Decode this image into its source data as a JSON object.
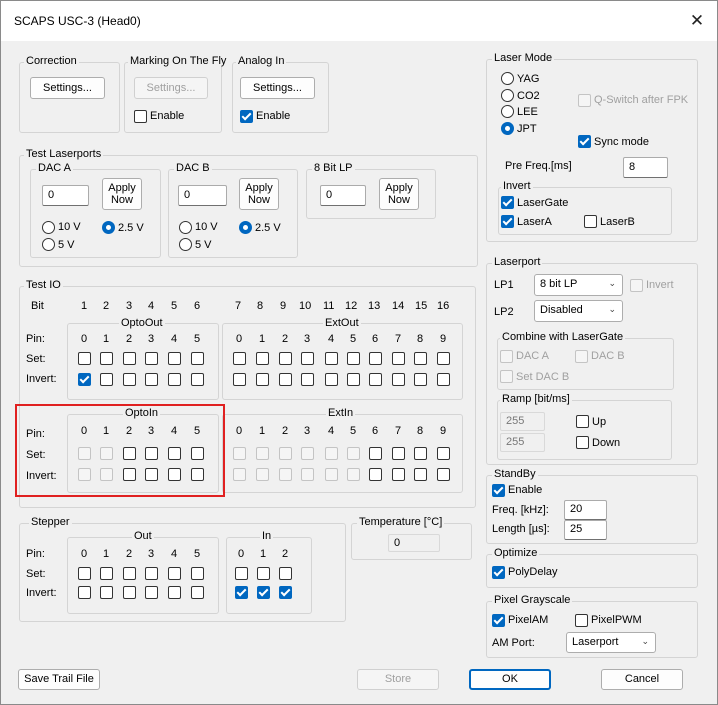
{
  "window": {
    "title": "SCAPS USC-3 (Head0)",
    "close_glyph": "✕"
  },
  "correction": {
    "title": "Correction",
    "settings": "Settings..."
  },
  "marking": {
    "title": "Marking On The Fly",
    "settings": "Settings...",
    "enable": "Enable",
    "enable_checked": false
  },
  "analog": {
    "title": "Analog In",
    "settings": "Settings...",
    "enable": "Enable",
    "enable_checked": true
  },
  "test_laserports": {
    "title": "Test Laserports",
    "dac_a": {
      "title": "DAC A",
      "value": "0",
      "apply": [
        "Apply",
        "Now"
      ],
      "r10": "10 V",
      "r25": "2.5 V",
      "r5": "5 V",
      "selected": "2.5 V"
    },
    "dac_b": {
      "title": "DAC B",
      "value": "0",
      "apply": [
        "Apply",
        "Now"
      ],
      "r10": "10 V",
      "r25": "2.5 V",
      "r5": "5 V",
      "selected": "2.5 V"
    },
    "lp8": {
      "title": "8 Bit LP",
      "value": "0",
      "apply": [
        "Apply",
        "Now"
      ]
    }
  },
  "test_io": {
    "title": "Test IO",
    "bit_label": "Bit",
    "bits_a": [
      "1",
      "2",
      "3",
      "4",
      "5",
      "6"
    ],
    "bits_b": [
      "7",
      "8",
      "9",
      "10",
      "11",
      "12",
      "13",
      "14",
      "15",
      "16"
    ],
    "pin": "Pin:",
    "set": "Set:",
    "invert": "Invert:",
    "optoout": {
      "title": "OptoOut",
      "pins": [
        "0",
        "1",
        "2",
        "3",
        "4",
        "5"
      ],
      "invert_checked": [
        true,
        false,
        false,
        false,
        false,
        false
      ]
    },
    "extout": {
      "title": "ExtOut",
      "pins": [
        "0",
        "1",
        "2",
        "3",
        "4",
        "5",
        "6",
        "7",
        "8",
        "9"
      ]
    },
    "optoin": {
      "title": "OptoIn",
      "pins": [
        "0",
        "1",
        "2",
        "3",
        "4",
        "5"
      ]
    },
    "extin": {
      "title": "ExtIn",
      "pins": [
        "0",
        "1",
        "2",
        "3",
        "4",
        "5",
        "6",
        "7",
        "8",
        "9"
      ]
    }
  },
  "stepper": {
    "title": "Stepper",
    "out_title": "Out",
    "in_title": "In",
    "pin": "Pin:",
    "set": "Set:",
    "invert": "Invert:",
    "out_pins": [
      "0",
      "1",
      "2",
      "3",
      "4",
      "5"
    ],
    "in_pins": [
      "0",
      "1",
      "2"
    ],
    "in_invert_checked": [
      true,
      true,
      true
    ]
  },
  "temperature": {
    "title": "Temperature [°C]",
    "value": "0"
  },
  "laser_mode": {
    "title": "Laser Mode",
    "options": [
      "YAG",
      "CO2",
      "LEE",
      "JPT"
    ],
    "selected": "JPT",
    "qswitch": "Q-Switch after FPK",
    "sync": "Sync mode",
    "sync_checked": true,
    "prefreq_label": "Pre Freq.[ms]",
    "prefreq_value": "8",
    "invert_title": "Invert",
    "lasergate": "LaserGate",
    "lasergate_checked": true,
    "lasera": "LaserA",
    "lasera_checked": true,
    "laserb": "LaserB",
    "laserb_checked": false
  },
  "laserport": {
    "title": "Laserport",
    "lp1_label": "LP1",
    "lp1_value": "8 bit LP",
    "invert": "Invert",
    "lp2_label": "LP2",
    "lp2_value": "Disabled",
    "combine_title": "Combine with LaserGate",
    "daca": "DAC A",
    "dacb": "DAC B",
    "setdacb": "Set DAC B",
    "ramp_title": "Ramp [bit/ms]",
    "ramp_up_value": "255",
    "ramp_down_value": "255",
    "up": "Up",
    "down": "Down"
  },
  "standby": {
    "title": "StandBy",
    "enable": "Enable",
    "enable_checked": true,
    "freq_label": "Freq. [kHz]:",
    "freq_value": "20",
    "length_label": "Length [µs]:",
    "length_value": "25"
  },
  "optimize": {
    "title": "Optimize",
    "polydelay": "PolyDelay",
    "polydelay_checked": true
  },
  "pixel": {
    "title": "Pixel Grayscale",
    "pixelam": "PixelAM",
    "pixelam_checked": true,
    "pixelpwm": "PixelPWM",
    "pixelpwm_checked": false,
    "amport_label": "AM Port:",
    "amport_value": "Laserport"
  },
  "footer": {
    "save": "Save Trail File",
    "store": "Store",
    "ok": "OK",
    "cancel": "Cancel"
  },
  "colors": {
    "accent": "#0067c0",
    "highlight": "#e02020",
    "background": "#f0f0f0"
  }
}
